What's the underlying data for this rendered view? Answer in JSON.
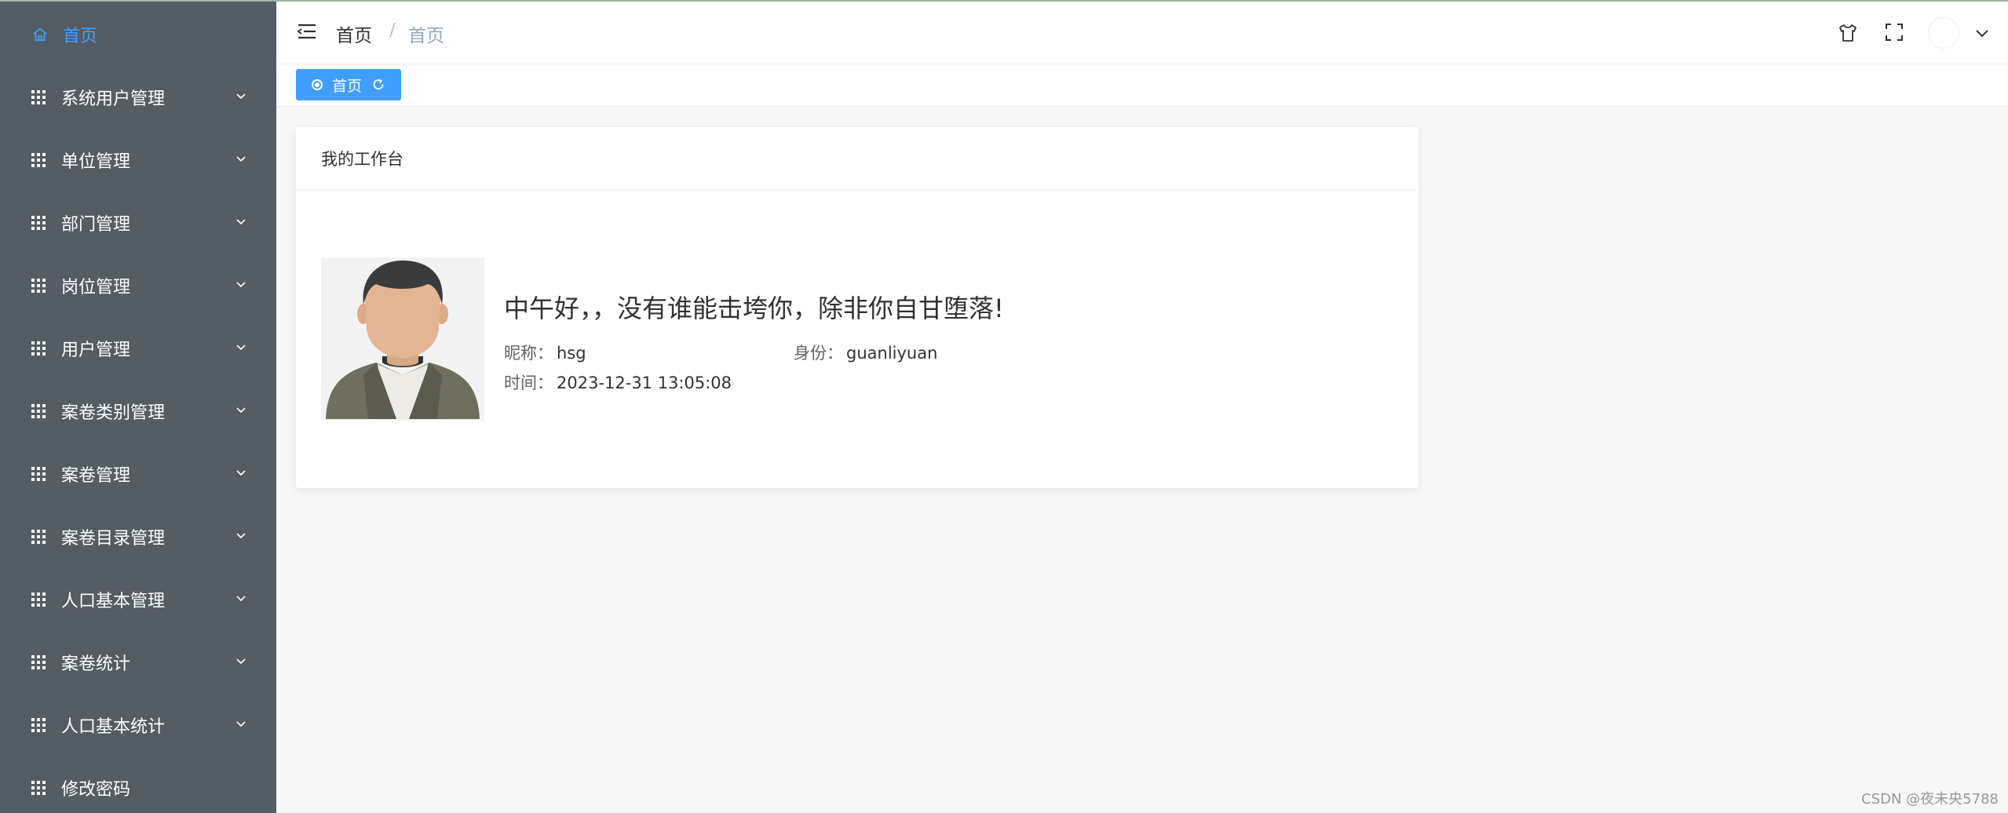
{
  "sidebar": {
    "items": [
      {
        "label": "首页",
        "icon": "home-icon",
        "active": true
      },
      {
        "label": "系统用户管理",
        "icon": "grid-icon"
      },
      {
        "label": "单位管理",
        "icon": "grid-icon"
      },
      {
        "label": "部门管理",
        "icon": "grid-icon"
      },
      {
        "label": "岗位管理",
        "icon": "grid-icon"
      },
      {
        "label": "用户管理",
        "icon": "grid-icon"
      },
      {
        "label": "案卷类别管理",
        "icon": "grid-icon"
      },
      {
        "label": "案卷管理",
        "icon": "grid-icon"
      },
      {
        "label": "案卷目录管理",
        "icon": "grid-icon"
      },
      {
        "label": "人口基本管理",
        "icon": "grid-icon"
      },
      {
        "label": "案卷统计",
        "icon": "grid-icon"
      },
      {
        "label": "人口基本统计",
        "icon": "grid-icon"
      },
      {
        "label": "修改密码",
        "icon": "grid-icon"
      }
    ]
  },
  "header": {
    "breadcrumb": [
      "首页",
      "首页"
    ],
    "separator": "/",
    "icons": [
      "hamburger-icon",
      "shirt-icon",
      "fullscreen-icon",
      "avatar",
      "chevron-down-icon"
    ]
  },
  "tags": {
    "active_tag": "首页"
  },
  "card": {
    "title": "我的工作台",
    "greeting": "中午好，，没有谁能击垮你，除非你自甘堕落!",
    "nickname_label": "昵称：",
    "nickname": "hsg",
    "role_label": "身份：",
    "role": "guanliyuan",
    "time_label": "时间：",
    "time": "2023-12-31 13:05:08"
  },
  "watermark": "CSDN @夜未央5788",
  "colors": {
    "sidebar_bg": "#545c64",
    "accent": "#409eff",
    "page_bg": "#f7f7f7"
  }
}
